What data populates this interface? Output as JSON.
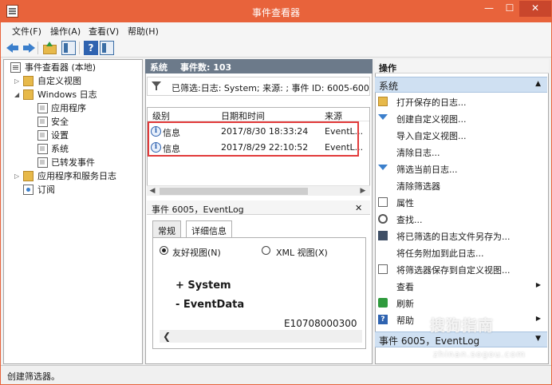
{
  "window": {
    "title": "事件查看器",
    "controls": {
      "minimize": "—",
      "maximize": "☐",
      "close": "✕"
    },
    "accent_color": "#e8633b"
  },
  "menu": [
    "文件(F)",
    "操作(A)",
    "查看(V)",
    "帮助(H)"
  ],
  "toolbar": {
    "help_label": "?"
  },
  "tree": {
    "root": "事件查看器 (本地)",
    "custom_views": "自定义视图",
    "windows_logs": "Windows 日志",
    "application": "应用程序",
    "security": "安全",
    "setup": "设置",
    "system": "系统",
    "forwarded": "已转发事件",
    "apps_services": "应用程序和服务日志",
    "subscriptions": "订阅"
  },
  "center": {
    "header_name": "系统",
    "header_count": "事件数: 103",
    "filter_text": "已筛选:日志: System; 来源: ; 事件 ID: 6005-6006。事",
    "columns": [
      "级别",
      "日期和时间",
      "来源"
    ],
    "rows": [
      {
        "level": "信息",
        "datetime": "2017/8/30 18:33:24",
        "source": "EventL..."
      },
      {
        "level": "信息",
        "datetime": "2017/8/29 22:10:52",
        "source": "EventL..."
      }
    ],
    "highlight_color": "#e23b3b"
  },
  "detail": {
    "title": "事件 6005，EventLog",
    "close": "✕",
    "tabs": [
      "常规",
      "详细信息"
    ],
    "radio_friendly": "友好视图(N)",
    "radio_xml": "XML 视图(X)",
    "node_system": "+ System",
    "node_eventdata": "- EventData",
    "hex_value": "E10708000300"
  },
  "actions": {
    "header": "操作",
    "section1": "系统",
    "items": [
      "打开保存的日志...",
      "创建自定义视图...",
      "导入自定义视图...",
      "清除日志...",
      "筛选当前日志...",
      "清除筛选器",
      "属性",
      "查找...",
      "将已筛选的日志文件另存为...",
      "将任务附加到此日志...",
      "将筛选器保存到自定义视图...",
      "查看",
      "刷新",
      "帮助"
    ],
    "section2": "事件 6005，EventLog"
  },
  "status_text": "创建筛选器。",
  "watermark": {
    "big": "搜狗指南",
    "small": "zhinan.sogou.com"
  }
}
